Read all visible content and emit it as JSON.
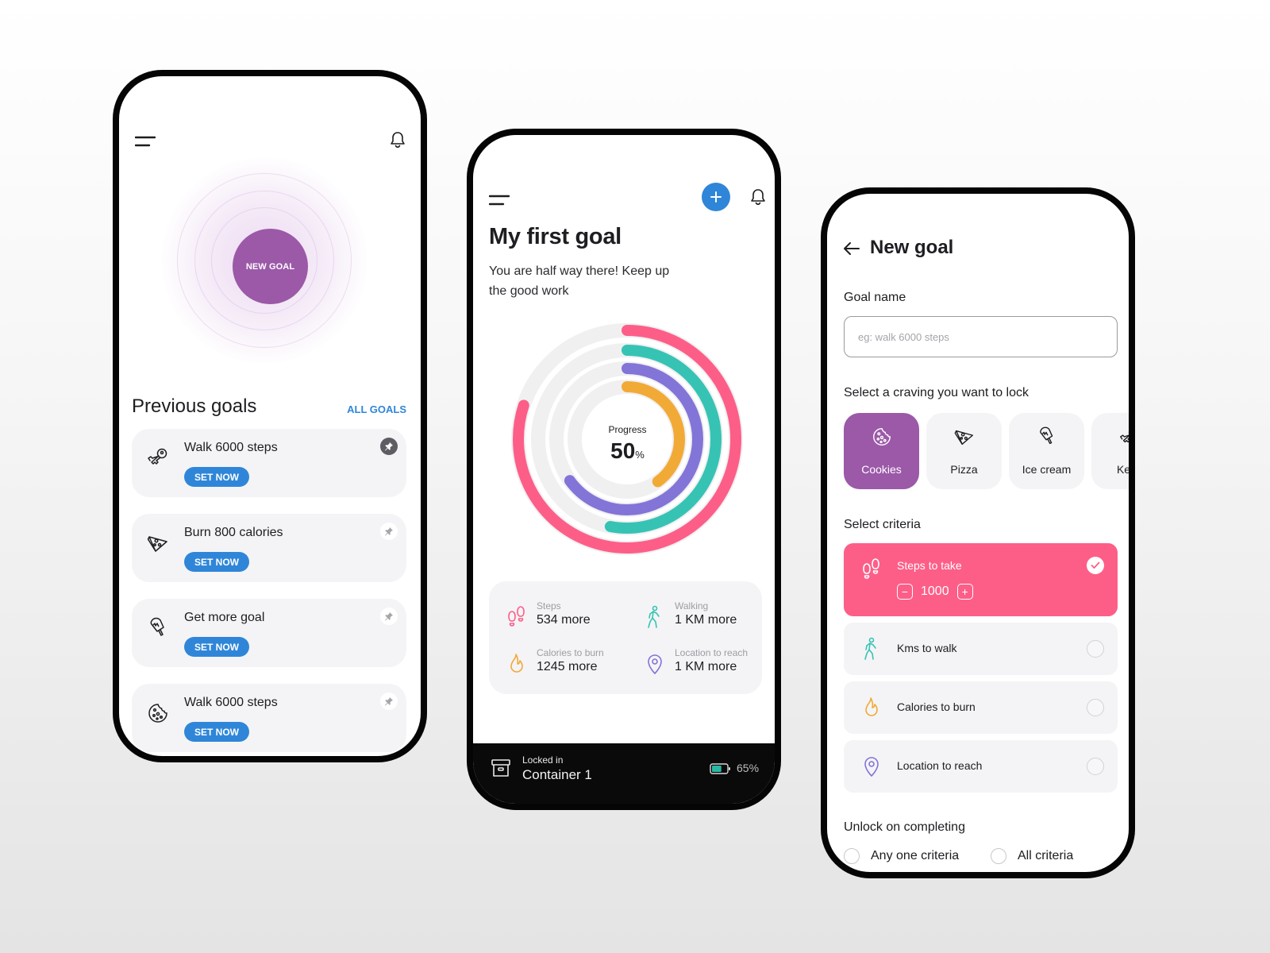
{
  "colors": {
    "brand_purple": "#9b59a8",
    "accent_blue": "#2f86d8",
    "pink": "#fd5e88",
    "teal": "#36c3b4",
    "violet": "#8374d8",
    "orange": "#f2aa36",
    "card_bg": "#f4f4f6"
  },
  "home_screen": {
    "menu_icon": "hamburger-menu-icon",
    "bell_icon": "bell-icon",
    "new_goal_label": "NEW GOAL",
    "section_title": "Previous goals",
    "all_goals_link": "ALL GOALS",
    "goals": [
      {
        "icon": "keys-icon",
        "name": "Walk 6000 steps",
        "button": "SET NOW",
        "pinned": true
      },
      {
        "icon": "pizza-icon",
        "name": "Burn 800 calories",
        "button": "SET NOW",
        "pinned": false
      },
      {
        "icon": "ice-cream-icon",
        "name": "Get more goal",
        "button": "SET NOW",
        "pinned": false
      },
      {
        "icon": "cookie-icon",
        "name": "Walk 6000 steps",
        "button": "SET NOW",
        "pinned": false
      }
    ]
  },
  "goal_screen": {
    "title": "My first goal",
    "subtitle": "You are half way there! Keep up the good work",
    "progress_label": "Progress",
    "progress_value": "50",
    "progress_unit": "%",
    "chart_data": {
      "type": "radial-bar",
      "title": "Progress",
      "center_value_percent": 50,
      "series": [
        {
          "name": "Steps",
          "color": "#fd5e88",
          "fraction": 0.8
        },
        {
          "name": "Walking",
          "color": "#36c3b4",
          "fraction": 0.53
        },
        {
          "name": "Location to reach",
          "color": "#8374d8",
          "fraction": 0.65
        },
        {
          "name": "Calories to burn",
          "color": "#f2aa36",
          "fraction": 0.4
        }
      ]
    },
    "stats": [
      {
        "icon": "footsteps-icon",
        "label": "Steps",
        "value": "534 more"
      },
      {
        "icon": "walking-person-icon",
        "label": "Walking",
        "value": "1 KM more"
      },
      {
        "icon": "flame-icon",
        "label": "Calories to burn",
        "value": "1245 more"
      },
      {
        "icon": "location-pin-icon",
        "label": "Location to reach",
        "value": "1 KM more"
      }
    ],
    "locked": {
      "label": "Locked in",
      "container": "Container 1",
      "battery_percent": "65%",
      "battery_level": 0.65
    }
  },
  "new_goal_screen": {
    "title": "New goal",
    "goal_name_label": "Goal name",
    "goal_name_value": "",
    "goal_name_placeholder": "eg: walk 6000 steps",
    "craving_label": "Select a craving you want to lock",
    "cravings": [
      {
        "icon": "cookie-icon",
        "label": "Cookies",
        "selected": true
      },
      {
        "icon": "pizza-icon",
        "label": "Pizza",
        "selected": false
      },
      {
        "icon": "ice-cream-icon",
        "label": "Ice cream",
        "selected": false
      },
      {
        "icon": "keys-icon",
        "label": "Keys",
        "selected": false
      }
    ],
    "criteria_label": "Select criteria",
    "criteria": [
      {
        "icon": "footsteps-icon",
        "label": "Steps to take",
        "selected": true,
        "value": "1000"
      },
      {
        "icon": "walking-person-icon",
        "label": "Kms to walk",
        "selected": false
      },
      {
        "icon": "flame-icon",
        "label": "Calories to burn",
        "selected": false
      },
      {
        "icon": "location-pin-icon",
        "label": "Location to reach",
        "selected": false
      }
    ],
    "unlock_label": "Unlock on completing",
    "unlock_options": [
      {
        "label": "Any one criteria",
        "selected": false
      },
      {
        "label": "All criteria",
        "selected": false
      }
    ]
  }
}
